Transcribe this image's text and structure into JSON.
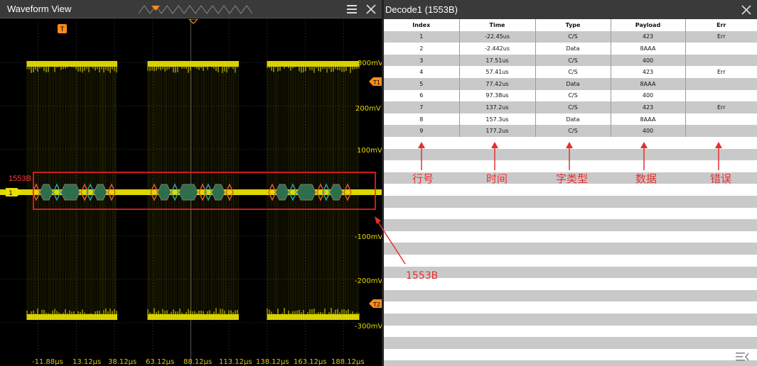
{
  "waveform": {
    "title": "Waveform View",
    "bus_label": "1553B",
    "channel_marker": "1",
    "trigger_marker": "T",
    "voltage_labels": [
      "300mV",
      "200mV",
      "100mV",
      "-100mV",
      "-200mV",
      "-300mV"
    ],
    "threshold_markers": [
      "T1",
      "T2"
    ],
    "time_labels": [
      "-11.88µs",
      "13.12µs",
      "38.12µs",
      "63.12µs",
      "88.12µs",
      "113.12µs",
      "138.12µs",
      "163.12µs",
      "188.12µs"
    ],
    "colors": {
      "trace": "#e8e000",
      "highlight": "#ff2020",
      "packet_fill": "#2f6e4a",
      "sync_red": "#e05a30",
      "sync_teal": "#2aa6a0",
      "marker_orange": "#ff8c1a"
    }
  },
  "decode": {
    "title": "Decode1 (1553B)",
    "columns": [
      "Index",
      "Time",
      "Type",
      "Payload",
      "Err"
    ],
    "rows": [
      [
        "1",
        "-22.45us",
        "C/S",
        "423",
        "Err"
      ],
      [
        "2",
        "-2.442us",
        "Data",
        "8AAA",
        ""
      ],
      [
        "3",
        "17.51us",
        "C/S",
        "400",
        ""
      ],
      [
        "4",
        "57.41us",
        "C/S",
        "423",
        "Err"
      ],
      [
        "5",
        "77.42us",
        "Data",
        "8AAA",
        ""
      ],
      [
        "6",
        "97.38us",
        "C/S",
        "400",
        ""
      ],
      [
        "7",
        "137.2us",
        "C/S",
        "423",
        "Err"
      ],
      [
        "8",
        "157.3us",
        "Data",
        "8AAA",
        ""
      ],
      [
        "9",
        "177.2us",
        "C/S",
        "400",
        ""
      ]
    ]
  },
  "annotations": {
    "column_labels": [
      "行号",
      "时间",
      "字类型",
      "数据",
      "错误"
    ],
    "bus_callout": "1553B"
  }
}
